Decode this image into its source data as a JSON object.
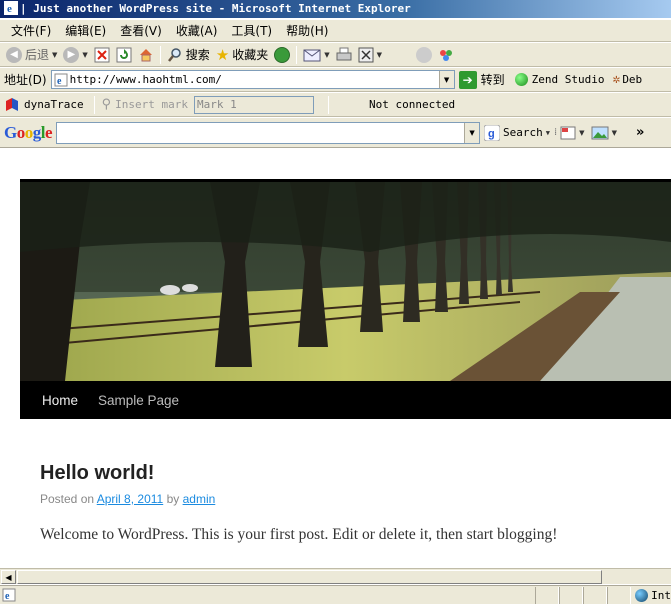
{
  "window": {
    "title": "| Just another WordPress site - Microsoft Internet Explorer"
  },
  "menu": [
    "文件(F)",
    "编辑(E)",
    "查看(V)",
    "收藏(A)",
    "工具(T)",
    "帮助(H)"
  ],
  "toolbar": {
    "back_label": "后退",
    "search_label": "搜索",
    "favorites_label": "收藏夹"
  },
  "address": {
    "label": "地址(D)",
    "url": "http://www.haohtml.com/",
    "go_label": "转到",
    "zend_label": "Zend Studio",
    "debug_label": "Deb"
  },
  "dynatrace": {
    "label": "dynaTrace",
    "insert_mark": "Insert mark",
    "mark_value": "Mark 1",
    "status": "Not connected"
  },
  "google": {
    "logo": "Google",
    "search_label": "Search",
    "more": "»"
  },
  "site": {
    "nav": [
      "Home",
      "Sample Page"
    ],
    "post": {
      "title": "Hello world!",
      "posted_on": "Posted on",
      "date": "April 8, 2011",
      "by": "by",
      "author": "admin",
      "body": "Welcome to WordPress. This is your first post. Edit or delete it, then start blogging!"
    }
  },
  "status": {
    "zone": "Int"
  },
  "colors": {
    "link": "#1b8be0",
    "nav_bg": "#000000",
    "chrome": "#ece9d8",
    "title_gradient_start": "#0a246a"
  }
}
